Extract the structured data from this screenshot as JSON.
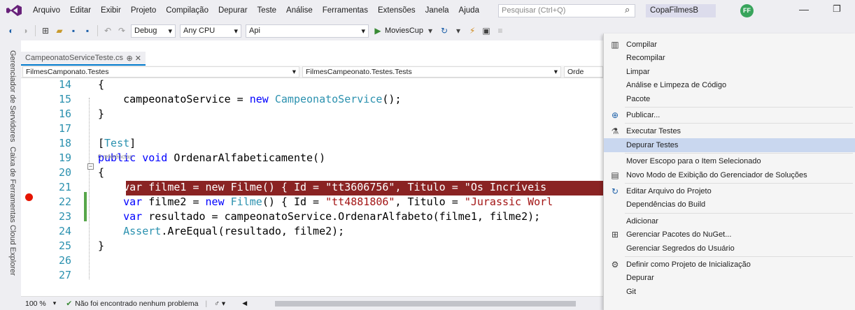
{
  "menubar": {
    "items": [
      "Arquivo",
      "Editar",
      "Exibir",
      "Projeto",
      "Compilação",
      "Depurar",
      "Teste",
      "Análise",
      "Ferramentas",
      "Extensões",
      "Janela",
      "Ajuda"
    ],
    "search_placeholder": "Pesquisar (Ctrl+Q)",
    "solution_name": "CopaFilmesB",
    "avatar_initials": "FF"
  },
  "toolbar": {
    "config": "Debug",
    "platform": "Any CPU",
    "project": "Api",
    "run_target": "MoviesCup"
  },
  "side_tabs": [
    "Gerenciador de Servidores",
    "Caixa de Ferramentas",
    "Cloud Explorer"
  ],
  "editor": {
    "tab_title": "CampeonatoServiceTeste.cs",
    "nav_project": "FilmesCamponato.Testes",
    "nav_class": "FilmesCampeonato.Testes.Tests",
    "nav_member": "Orde",
    "codelens": "0 referências",
    "lines": [
      {
        "n": "14",
        "parts": [
          [
            "",
            "{"
          ]
        ]
      },
      {
        "n": "15",
        "parts": [
          [
            "",
            "    campeonatoService = "
          ],
          [
            "kw",
            "new"
          ],
          [
            "",
            " "
          ],
          [
            "ty",
            "CampeonatoService"
          ],
          [
            "",
            "();"
          ]
        ]
      },
      {
        "n": "16",
        "parts": [
          [
            "",
            "}"
          ]
        ]
      },
      {
        "n": "17",
        "parts": [
          [
            "",
            ""
          ]
        ]
      },
      {
        "n": "18",
        "parts": [
          [
            "",
            "["
          ],
          [
            "ty",
            "Test"
          ],
          [
            "",
            "]"
          ]
        ]
      },
      {
        "n": "19",
        "parts": [
          [
            "kw",
            "public"
          ],
          [
            "",
            " "
          ],
          [
            "kw",
            "void"
          ],
          [
            "",
            " OrdenarAlfabeticamente()"
          ]
        ]
      },
      {
        "n": "20",
        "parts": [
          [
            "",
            "{"
          ]
        ]
      },
      {
        "n": "21",
        "parts": [
          [
            "",
            "    var filme1 = new Filme() { Id = \"tt3606756\", Titulo = \"Os Incríveis"
          ]
        ],
        "highlight": true
      },
      {
        "n": "22",
        "parts": [
          [
            "",
            "    "
          ],
          [
            "kw",
            "var"
          ],
          [
            "",
            " filme2 = "
          ],
          [
            "kw",
            "new"
          ],
          [
            "",
            " "
          ],
          [
            "ty",
            "Filme"
          ],
          [
            "",
            "() { Id = "
          ],
          [
            "st",
            "\"tt4881806\""
          ],
          [
            "",
            ", Titulo = "
          ],
          [
            "st",
            "\"Jurassic Worl"
          ]
        ]
      },
      {
        "n": "23",
        "parts": [
          [
            "",
            "    "
          ],
          [
            "kw",
            "var"
          ],
          [
            "",
            " resultado = campeonatoService.OrdenarAlfabeto(filme1, filme2);"
          ]
        ]
      },
      {
        "n": "24",
        "parts": [
          [
            "",
            "    "
          ],
          [
            "ty",
            "Assert"
          ],
          [
            "",
            ".AreEqual(resultado, filme2);"
          ]
        ]
      },
      {
        "n": "25",
        "parts": [
          [
            "",
            "}"
          ]
        ]
      },
      {
        "n": "26",
        "parts": [
          [
            "",
            ""
          ]
        ]
      },
      {
        "n": "27",
        "parts": [
          [
            "",
            ""
          ]
        ]
      }
    ]
  },
  "status": {
    "zoom": "100 %",
    "message": "Não foi encontrado nenhum problema"
  },
  "context_menu": {
    "items": [
      {
        "label": "Compilar",
        "icon": "build-icon"
      },
      {
        "label": "Recompilar"
      },
      {
        "label": "Limpar"
      },
      {
        "label": "Análise e Limpeza de Código"
      },
      {
        "label": "Pacote"
      },
      {
        "label": "Publicar...",
        "icon": "globe-icon"
      },
      {
        "label": "Executar Testes",
        "icon": "test-icon"
      },
      {
        "label": "Depurar Testes",
        "selected": true
      },
      {
        "label": "Mover Escopo para o Item Selecionado"
      },
      {
        "label": "Novo Modo de Exibição do Gerenciador de Soluções",
        "icon": "window-icon"
      },
      {
        "label": "Editar Arquivo do Projeto",
        "icon": "edit-arrow-icon"
      },
      {
        "label": "Dependências do Build"
      },
      {
        "label": "Adicionar"
      },
      {
        "label": "Gerenciar Pacotes do NuGet...",
        "icon": "nuget-icon"
      },
      {
        "label": "Gerenciar Segredos do Usuário"
      },
      {
        "label": "Definir como Projeto de Inicialização",
        "icon": "gear-icon"
      },
      {
        "label": "Depurar"
      },
      {
        "label": "Git"
      }
    ]
  }
}
